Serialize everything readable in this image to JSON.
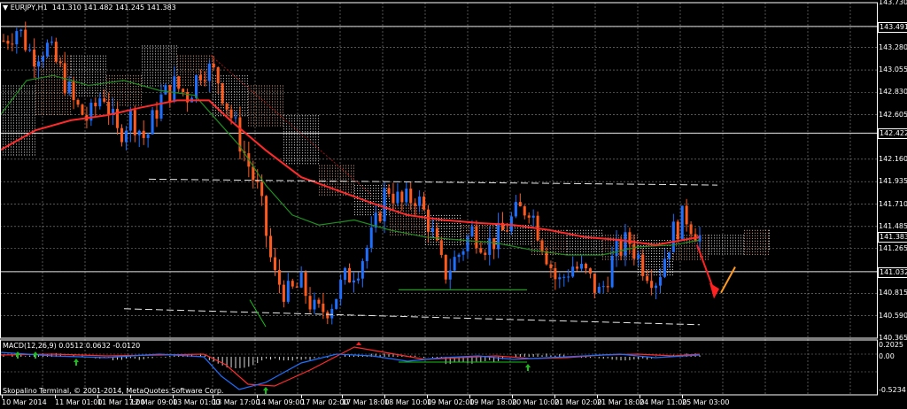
{
  "header": {
    "symbol_label": "EURJPY,H1  141.310 141.482 141.245 141.383"
  },
  "indicator": {
    "label": "MACD(12,26,9) 0.0512 0.0632 -0.0120"
  },
  "footer": {
    "copyright": "Skopalino Terminal, © 2001-2014, MetaQuotes Software Corp."
  },
  "price_axis": {
    "labels": [
      "143.730",
      "143.491",
      "143.280",
      "143.055",
      "142.830",
      "142.605",
      "142.422",
      "142.160",
      "141.935",
      "141.710",
      "141.485",
      "141.383",
      "141.265",
      "141.032",
      "140.815",
      "140.590",
      "140.365"
    ],
    "boxed": [
      "143.491",
      "142.422",
      "141.383",
      "141.032"
    ]
  },
  "macd_axis": {
    "labels": [
      "0.2025",
      "0.00",
      "-0.5234"
    ]
  },
  "time_axis": {
    "labels": [
      "10 Mar 2014",
      "11 Mar 01:00",
      "11 Mar 17:00",
      "12 Mar 09:00",
      "13 Mar 01:00",
      "13 Mar 17:00",
      "14 Mar 09:00",
      "17 Mar 02:00",
      "17 Mar 18:00",
      "18 Mar 10:00",
      "19 Mar 02:00",
      "19 Mar 18:00",
      "20 Mar 10:00",
      "21 Mar 02:00",
      "21 Mar 18:00",
      "24 Mar 11:00",
      "25 Mar 03:00"
    ]
  },
  "colors": {
    "background": "#000000",
    "grid": "#8a8a8a",
    "bull_candle": "#1e6fff",
    "bear_candle": "#ff5a1e",
    "ma_red": "#ff2a2a",
    "ma_green": "#1f8f1f",
    "cloud_a": "#e0a080",
    "cloud_b": "#d8d8d8",
    "macd_line": "#1e6fff",
    "signal_line": "#ff2a2a"
  },
  "chart_data": {
    "type": "candlestick",
    "symbol": "EURJPY",
    "timeframe": "H1",
    "ohlc_current": {
      "open": 141.31,
      "high": 141.482,
      "low": 141.245,
      "close": 141.383
    },
    "ylim": [
      140.365,
      143.73
    ],
    "x_ticks": [
      "10 Mar 2014",
      "11 Mar 01:00",
      "11 Mar 17:00",
      "12 Mar 09:00",
      "13 Mar 01:00",
      "13 Mar 17:00",
      "14 Mar 09:00",
      "17 Mar 02:00",
      "17 Mar 18:00",
      "18 Mar 10:00",
      "19 Mar 02:00",
      "19 Mar 18:00",
      "20 Mar 10:00",
      "21 Mar 02:00",
      "21 Mar 18:00",
      "24 Mar 11:00",
      "25 Mar 03:00"
    ],
    "close_path": [
      143.35,
      143.48,
      143.2,
      143.3,
      143.05,
      142.7,
      142.55,
      142.85,
      142.4,
      142.6,
      142.35,
      142.75,
      142.9,
      142.8,
      143.1,
      143.0,
      142.6,
      142.2,
      141.8,
      141.0,
      140.8,
      140.9,
      140.6,
      140.7,
      140.95,
      141.1,
      141.4,
      141.9,
      141.7,
      141.8,
      141.5,
      141.0,
      141.2,
      141.45,
      141.3,
      141.4,
      141.6,
      141.7,
      141.3,
      140.9,
      141.1,
      141.0,
      140.8,
      141.2,
      141.35,
      141.1,
      140.95,
      141.4,
      141.6,
      141.38
    ],
    "macd": {
      "main": 0.0512,
      "signal": 0.0632,
      "histogram": -0.012,
      "ylim": [
        -0.5234,
        0.2025
      ]
    },
    "grid": true
  }
}
